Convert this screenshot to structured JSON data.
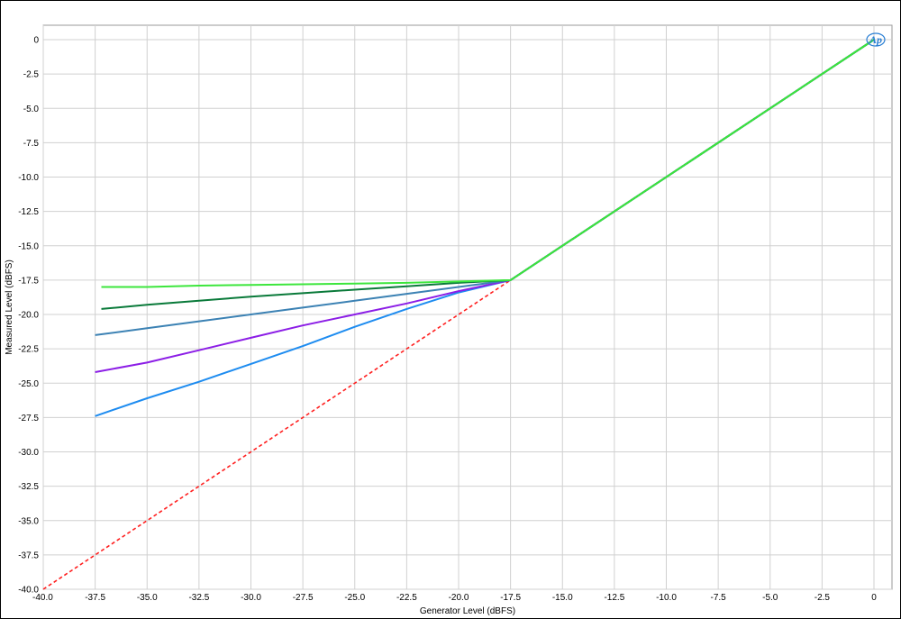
{
  "chart_data": {
    "type": "line",
    "xlabel": "Generator Level (dBFS)",
    "ylabel": "Measured Level (dBFS)",
    "xlim": [
      -40,
      0
    ],
    "ylim": [
      -40,
      0
    ],
    "x_ticks": [
      "-40.0",
      "-37.5",
      "-35.0",
      "-32.5",
      "-30.0",
      "-27.5",
      "-25.0",
      "-22.5",
      "-20.0",
      "-17.5",
      "-15.0",
      "-12.5",
      "-10.0",
      "-7.5",
      "-5.0",
      "-2.5",
      "0"
    ],
    "y_ticks": [
      "0",
      "-2.5",
      "-5.0",
      "-7.5",
      "-10.0",
      "-12.5",
      "-15.0",
      "-17.5",
      "-20.0",
      "-22.5",
      "-25.0",
      "-27.5",
      "-30.0",
      "-32.5",
      "-35.0",
      "-37.5",
      "-40.0"
    ],
    "grid": true,
    "logo": "Ap",
    "series": [
      {
        "color": "#ff2020",
        "dashed": true,
        "x": [
          -40,
          -17.5,
          0
        ],
        "y": [
          -40,
          -17.5,
          0
        ]
      },
      {
        "color": "#1e8cf0",
        "dashed": false,
        "x": [
          -37.5,
          -35,
          -32.5,
          -30,
          -27.5,
          -25,
          -22.5,
          -20,
          -17.5,
          0
        ],
        "y": [
          -27.4,
          -26.1,
          -24.9,
          -23.6,
          -22.3,
          -20.9,
          -19.6,
          -18.4,
          -17.5,
          0
        ]
      },
      {
        "color": "#8c1ee6",
        "dashed": false,
        "x": [
          -37.5,
          -35,
          -32.5,
          -30,
          -27.5,
          -25,
          -22.5,
          -20,
          -17.5,
          0
        ],
        "y": [
          -24.2,
          -23.5,
          -22.6,
          -21.7,
          -20.8,
          -20.0,
          -19.2,
          -18.3,
          -17.5,
          0
        ]
      },
      {
        "color": "#3c82b4",
        "dashed": false,
        "x": [
          -37.5,
          -35,
          -32.5,
          -30,
          -27.5,
          -25,
          -22.5,
          -20,
          -17.5,
          0
        ],
        "y": [
          -21.5,
          -21.0,
          -20.5,
          -20.0,
          -19.5,
          -19.0,
          -18.5,
          -18.0,
          -17.5,
          0
        ]
      },
      {
        "color": "#0a7a3a",
        "dashed": false,
        "x": [
          -37.2,
          -35,
          -32.5,
          -30,
          -27.5,
          -25,
          -22.5,
          -20,
          -17.5,
          0
        ],
        "y": [
          -19.6,
          -19.3,
          -19.0,
          -18.7,
          -18.45,
          -18.2,
          -17.95,
          -17.7,
          -17.5,
          0
        ]
      },
      {
        "color": "#3ce63c",
        "dashed": false,
        "x": [
          -37.2,
          -35,
          -32.5,
          -30,
          -27.5,
          -25,
          -22.5,
          -20,
          -17.5,
          0
        ],
        "y": [
          -18.0,
          -18.0,
          -17.9,
          -17.85,
          -17.8,
          -17.75,
          -17.7,
          -17.6,
          -17.5,
          0
        ]
      }
    ]
  }
}
